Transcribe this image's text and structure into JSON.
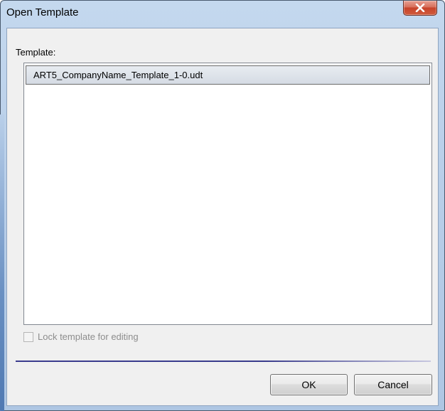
{
  "window": {
    "title": "Open Template"
  },
  "form": {
    "template_label": "Template:",
    "template_items": [
      "ART5_CompanyName_Template_1-0.udt"
    ],
    "lock_label": "Lock template for editing"
  },
  "buttons": {
    "ok": "OK",
    "cancel": "Cancel"
  },
  "icons": {
    "close": "close-icon"
  },
  "colors": {
    "close_button": "#c7432a",
    "selection": "#d5dbe4",
    "separator": "#3b3c8e"
  }
}
